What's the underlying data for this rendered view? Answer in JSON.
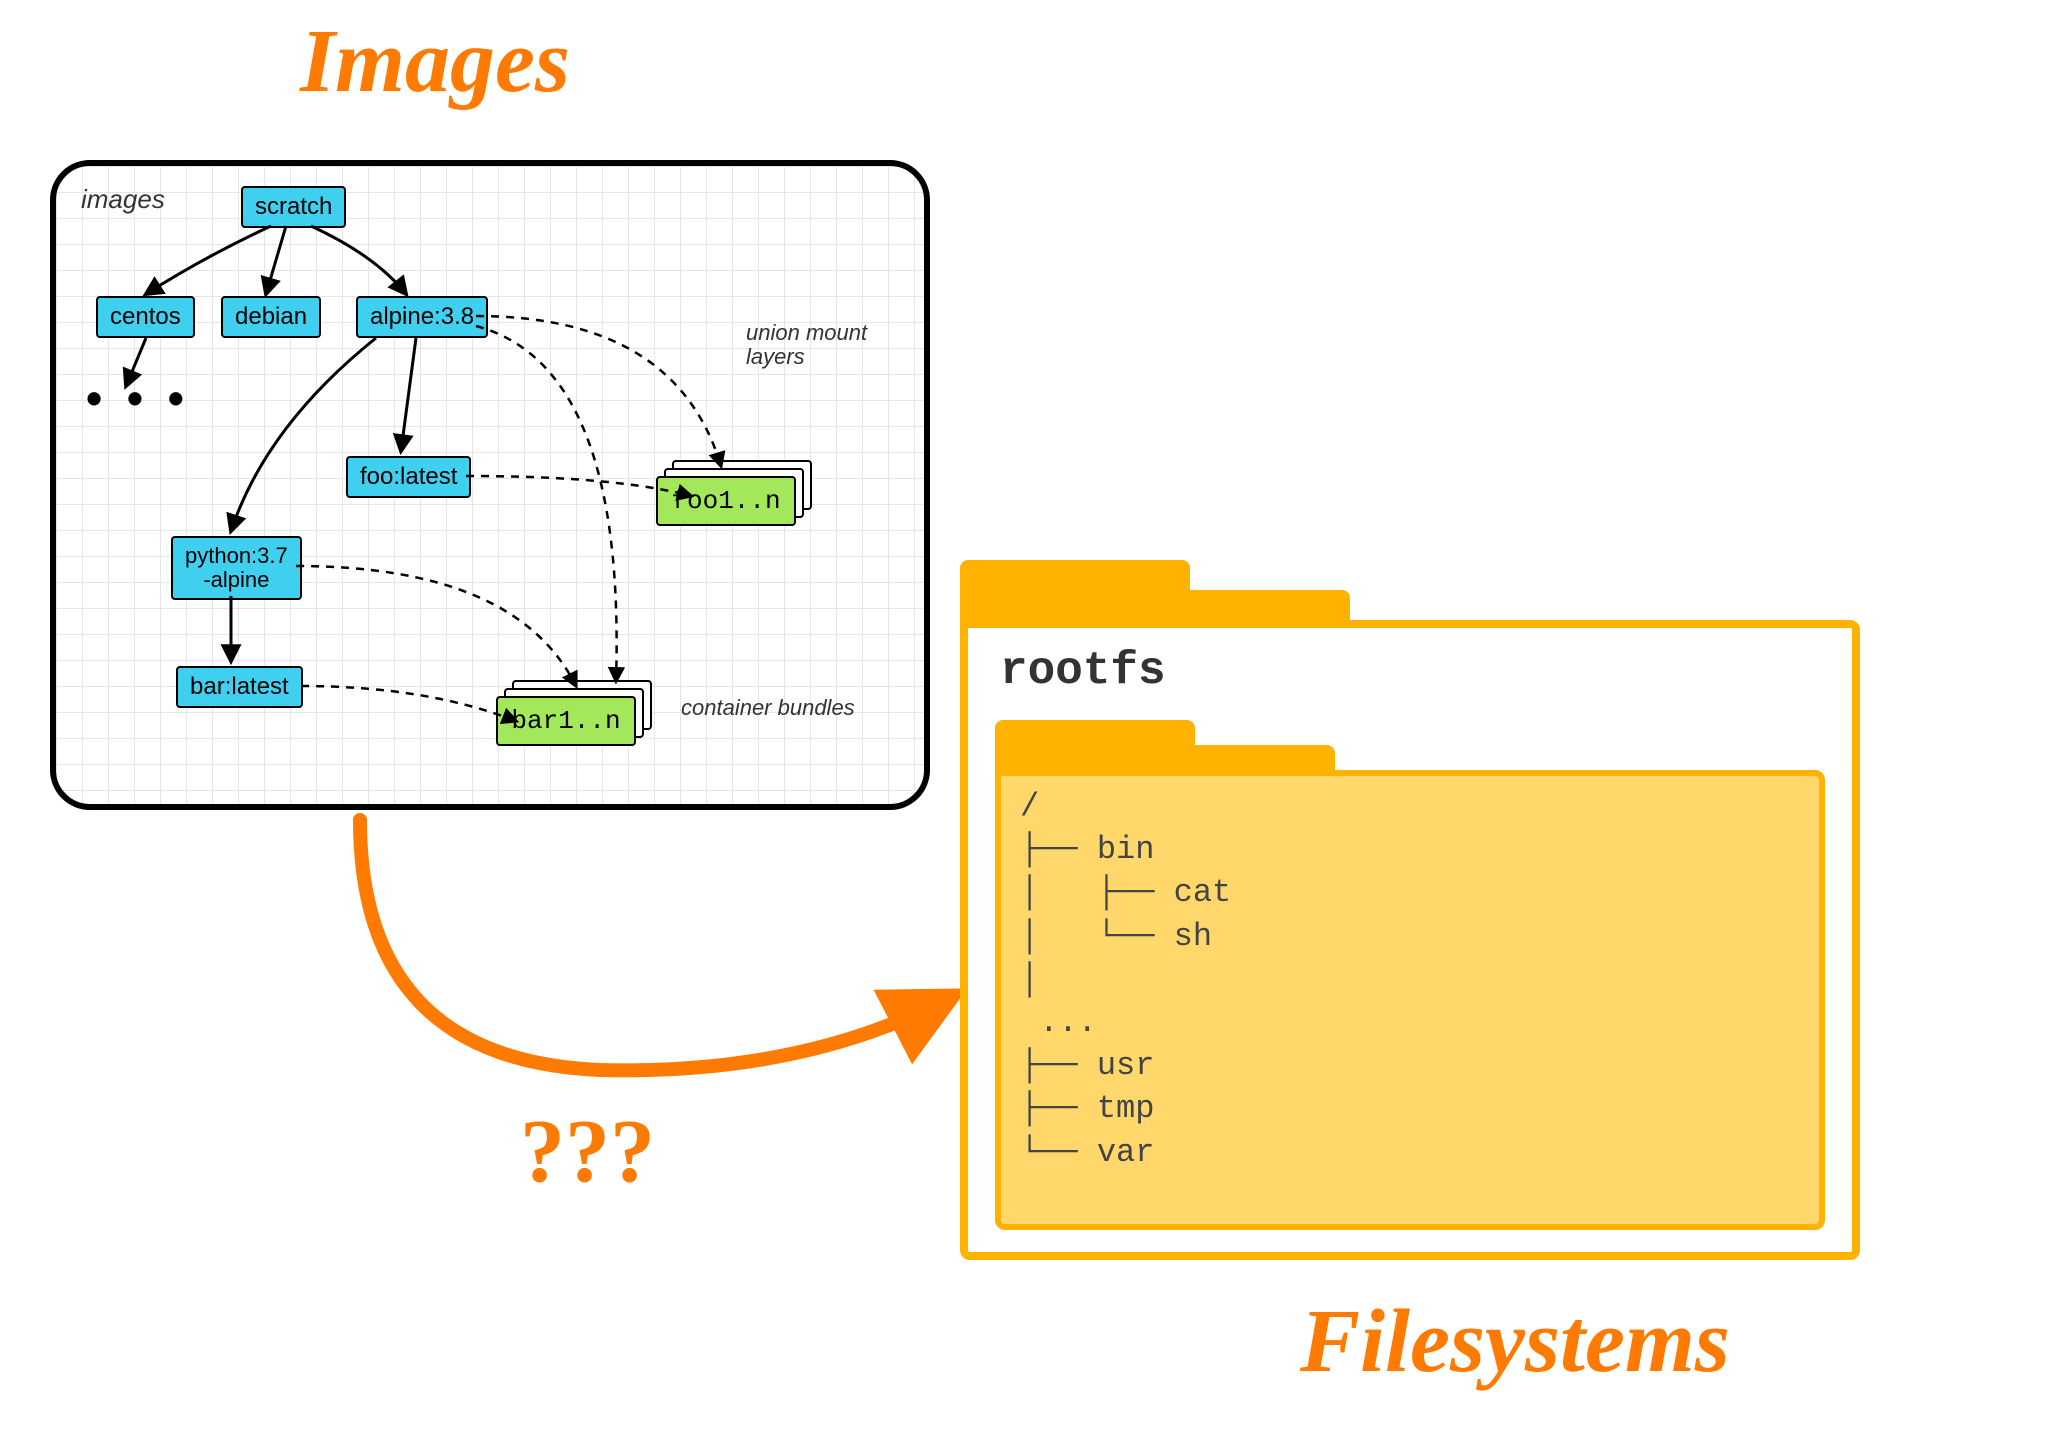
{
  "titles": {
    "images": "Images",
    "filesystems": "Filesystems",
    "question": "???"
  },
  "images_panel": {
    "label": "images",
    "annotations": {
      "union_mount": "union mount\nlayers",
      "container_bundles": "container\nbundles"
    },
    "nodes": {
      "scratch": "scratch",
      "centos": "centos",
      "debian": "debian",
      "alpine": "alpine:3.8",
      "foo_latest": "foo:latest",
      "python_alpine": "python:3.7\n-alpine",
      "bar_latest": "bar:latest"
    },
    "bundles": {
      "foo": "foo1..n",
      "bar": "bar1..n"
    },
    "ellipsis": "• • •"
  },
  "filesystem": {
    "rootfs_label": "rootfs",
    "tree": "/\n├── bin\n│   ├── cat\n│   └── sh\n│\n ...\n├── usr\n├── tmp\n└── var"
  }
}
